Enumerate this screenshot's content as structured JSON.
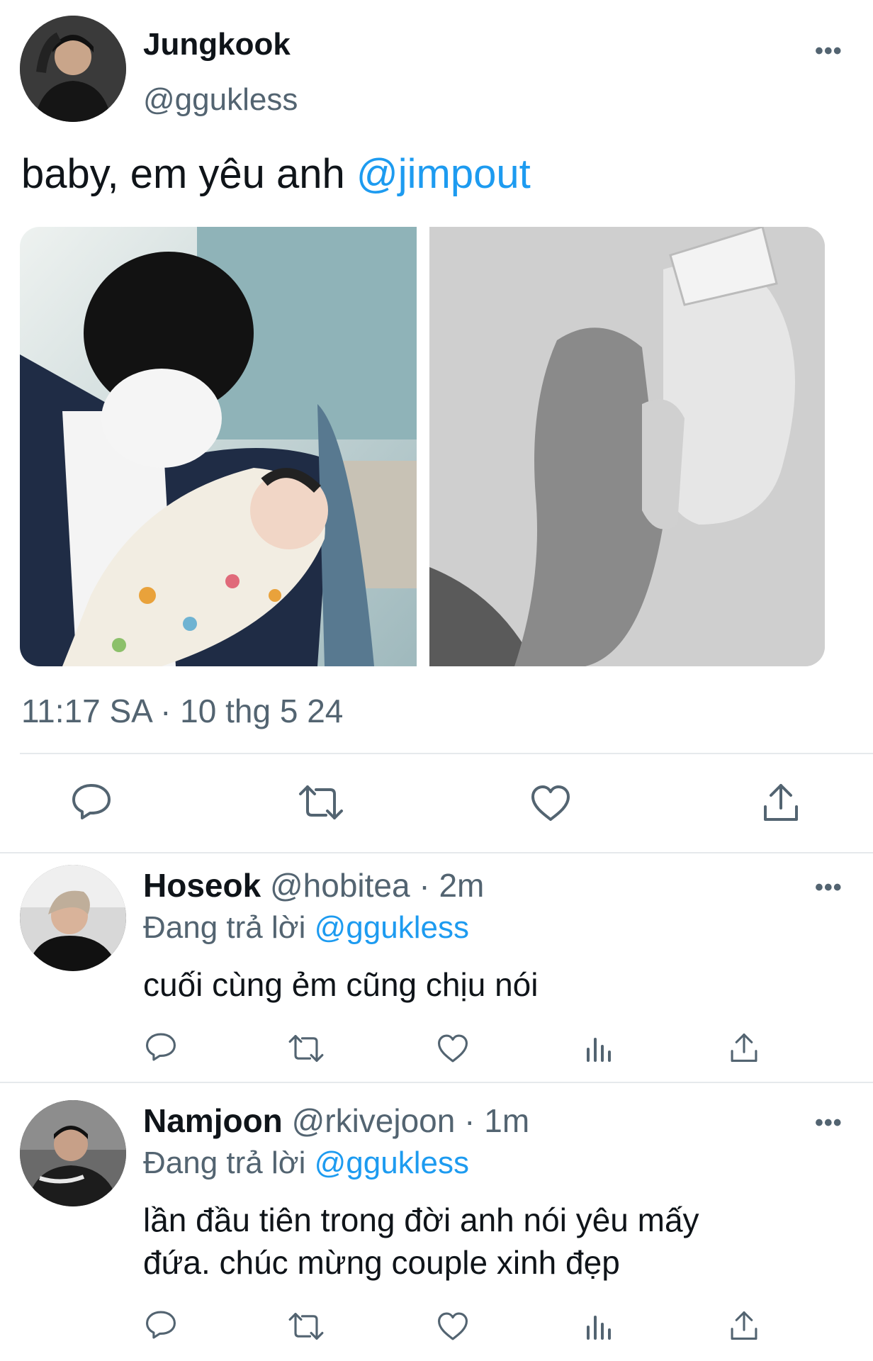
{
  "main_tweet": {
    "display_name": "Jungkook",
    "handle": "@ggukless",
    "text": "baby, em yêu anh ",
    "mention": "@jimpout",
    "timestamp": "11:17 SA · 10 thg 5 24",
    "images": [
      "photo-man-holding-baby",
      "photo-holding-hands-bw"
    ]
  },
  "replies": [
    {
      "display_name": "Hoseok",
      "handle": "@hobitea",
      "time": "· 2m",
      "replying_prefix": "Đang trả lời ",
      "replying_to": "@ggukless",
      "text": "cuối cùng ẻm cũng chịu nói"
    },
    {
      "display_name": "Namjoon",
      "handle": "@rkivejoon",
      "time": "· 1m",
      "replying_prefix": "Đang trả lời ",
      "replying_to": "@ggukless",
      "text_line1": "lần đầu tiên trong đời anh nói yêu mấy",
      "text_line2": "đứa. chúc mừng couple xinh đẹp"
    }
  ],
  "more_label": "•••",
  "icons": [
    "reply-icon",
    "retweet-icon",
    "like-icon",
    "analytics-icon",
    "share-icon"
  ],
  "colors": {
    "accent": "#1d9bf0",
    "secondary_text": "#536471",
    "divider": "#e6e9ec"
  }
}
